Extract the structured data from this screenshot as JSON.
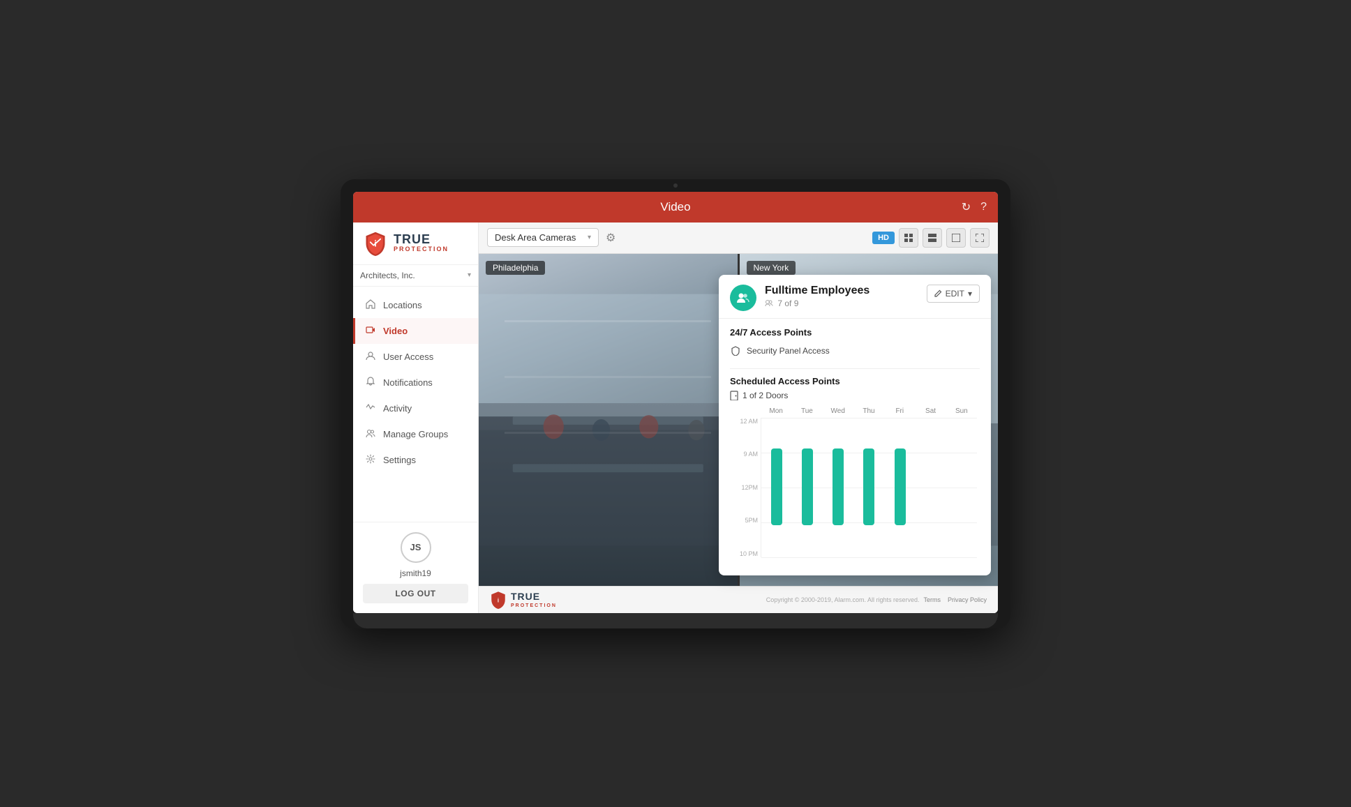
{
  "header": {
    "title": "Video",
    "refresh_label": "↻",
    "help_label": "?"
  },
  "account": {
    "name": "Architects, Inc."
  },
  "toolbar": {
    "camera_dropdown": "Desk Area Cameras",
    "hd_label": "HD",
    "settings_icon": "⚙",
    "chevron": "▾"
  },
  "sidebar": {
    "logo_true": "TRUE",
    "logo_protection": "PROTECTION",
    "items": [
      {
        "id": "locations",
        "label": "Locations",
        "icon": "🏠",
        "active": false
      },
      {
        "id": "video",
        "label": "Video",
        "icon": "📹",
        "active": true
      },
      {
        "id": "user-access",
        "label": "User Access",
        "icon": "👤",
        "active": false
      },
      {
        "id": "notifications",
        "label": "Notifications",
        "icon": "🔔",
        "active": false
      },
      {
        "id": "activity",
        "label": "Activity",
        "icon": "📊",
        "active": false
      },
      {
        "id": "manage-groups",
        "label": "Manage Groups",
        "icon": "👥",
        "active": false
      },
      {
        "id": "settings",
        "label": "Settings",
        "icon": "⚙",
        "active": false
      }
    ],
    "user": {
      "initials": "JS",
      "username": "jsmith19",
      "logout": "LOG OUT"
    }
  },
  "camera_feeds": [
    {
      "id": "main",
      "label": "Philadelphia"
    },
    {
      "id": "secondary",
      "label": "New York"
    }
  ],
  "panel": {
    "group_name": "Fulltime Employees",
    "member_count": "7 of 9",
    "edit_label": "EDIT",
    "access_247_title": "24/7 Access Points",
    "security_panel": "Security Panel Access",
    "scheduled_title": "Scheduled Access Points",
    "doors_label": "1 of 2 Doors",
    "chart": {
      "days": [
        "Mon",
        "Tue",
        "Wed",
        "Thu",
        "Fri",
        "Sat",
        "Sun"
      ],
      "time_labels": [
        "12 AM",
        "9 AM",
        "12PM",
        "5PM",
        "10 PM"
      ],
      "bars": [
        {
          "day": "Mon",
          "active": true,
          "top_pct": 22,
          "height_pct": 55
        },
        {
          "day": "Tue",
          "active": true,
          "top_pct": 22,
          "height_pct": 55
        },
        {
          "day": "Wed",
          "active": true,
          "top_pct": 22,
          "height_pct": 55
        },
        {
          "day": "Thu",
          "active": true,
          "top_pct": 22,
          "height_pct": 55
        },
        {
          "day": "Fri",
          "active": true,
          "top_pct": 22,
          "height_pct": 55
        },
        {
          "day": "Sat",
          "active": false,
          "top_pct": 0,
          "height_pct": 0
        },
        {
          "day": "Sun",
          "active": false,
          "top_pct": 0,
          "height_pct": 0
        }
      ]
    }
  },
  "footer": {
    "logo_true": "TRUE",
    "logo_protection": "PROTECTION",
    "copyright": "Copyright © 2000-2019, Alarm.com. All rights reserved.",
    "links": [
      "Terms",
      "Privacy Policy"
    ]
  }
}
